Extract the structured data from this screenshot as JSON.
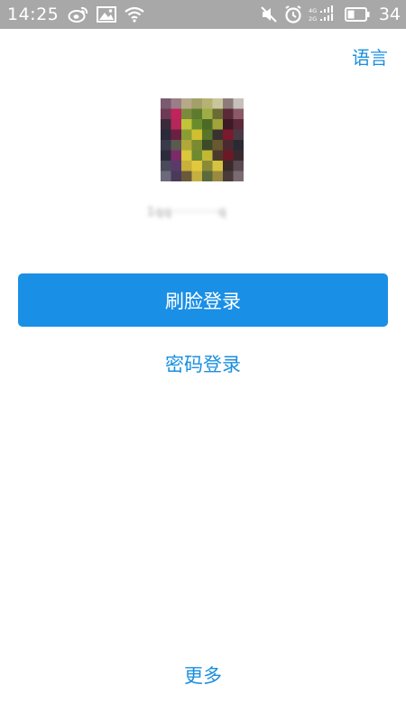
{
  "status_bar": {
    "time": "14:25",
    "battery_level": "34",
    "left_icons": [
      "weibo-icon",
      "image-icon",
      "wifi-icon"
    ],
    "right_icons": [
      "mute-icon",
      "alarm-icon",
      "signal-icon",
      "battery-icon"
    ]
  },
  "header": {
    "language_label": "语言"
  },
  "account": {
    "name_blurred": "1qq··········q"
  },
  "actions": {
    "face_login_label": "刷脸登录",
    "password_login_label": "密码登录",
    "more_label": "更多"
  },
  "colors": {
    "accent": "#1a8fe6",
    "link": "#1a8fde",
    "status_bar_bg": "#a8a8a8",
    "background": "#ffffff"
  }
}
